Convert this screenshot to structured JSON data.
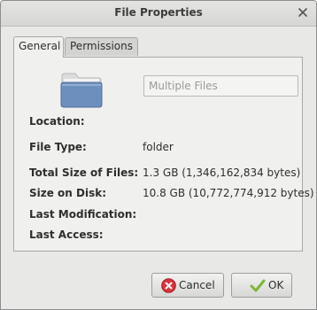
{
  "window": {
    "title": "File Properties"
  },
  "tabs": [
    {
      "label": "General",
      "selected": true
    },
    {
      "label": "Permissions",
      "selected": false
    }
  ],
  "general": {
    "name_placeholder": "Multiple Files",
    "location_label": "Location:",
    "location_value": "",
    "file_type_label": "File Type:",
    "file_type_value": "folder",
    "total_size_label": "Total Size of Files:",
    "total_size_value": "1.3 GB (1,346,162,834 bytes)",
    "disk_size_label": "Size on Disk:",
    "disk_size_value": "10.8 GB (10,772,774,912 bytes)",
    "modification_label": "Last Modification:",
    "modification_value": "",
    "access_label": "Last Access:",
    "access_value": ""
  },
  "buttons": {
    "cancel": "Cancel",
    "ok": "OK"
  },
  "icons": {
    "close": "close-icon",
    "folder": "folder-icon",
    "cancel": "cancel-icon",
    "ok": "checkmark-icon"
  },
  "colors": {
    "folder": "#6d8fbe",
    "cancel_icon": "#d9333b",
    "ok_icon": "#7cb63a"
  }
}
